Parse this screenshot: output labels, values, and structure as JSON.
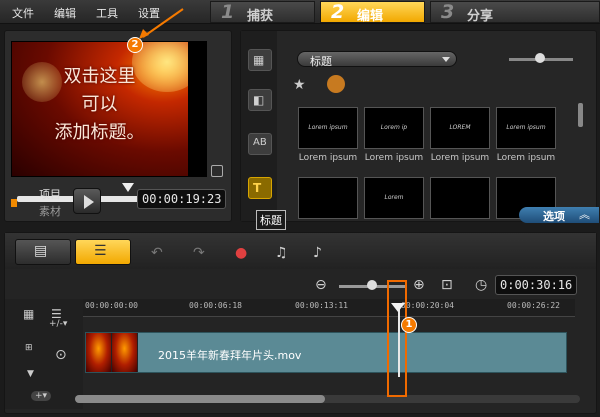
{
  "menu": [
    "文件",
    "编辑",
    "工具",
    "设置"
  ],
  "steps": [
    {
      "num": "1",
      "label": "捕获",
      "active": false
    },
    {
      "num": "2",
      "label": "编辑",
      "active": true
    },
    {
      "num": "3",
      "label": "分享",
      "active": false
    }
  ],
  "preview": {
    "overlay_lines": [
      "双击这里",
      "可以",
      "添加标题。"
    ],
    "project_label": "项目",
    "clip_label": "素材",
    "timecode": "00:00:19:23"
  },
  "library": {
    "category": "标题",
    "thumbs": [
      {
        "text": "Lorem ipsum",
        "caption": "Lorem ipsum"
      },
      {
        "text": "Lorem ip",
        "caption": "Lorem ipsum"
      },
      {
        "text": "LOREM",
        "caption": "Lorem ipsum"
      },
      {
        "text": "Lorem ipsum",
        "caption": "Lorem ipsum"
      },
      {
        "text": "",
        "caption": ""
      },
      {
        "text": "Lorem",
        "caption": ""
      },
      {
        "text": "",
        "caption": ""
      },
      {
        "text": "",
        "caption": ""
      }
    ],
    "options_label": "选项",
    "tooltip": "标题"
  },
  "timeline": {
    "total_time": "0:00:30:16",
    "ruler_marks": [
      "00:00:00:00",
      "00:00:06:18",
      "00:00:13:11",
      "00:00:20:04",
      "00:00:26:22"
    ],
    "clip_name": "2015羊年新春拜年片头.mov",
    "badge_1": "1",
    "badge_2": "2"
  },
  "colors": {
    "accent": "#f2a800",
    "highlight": "#f06a00",
    "clip": "#5b8a95"
  }
}
